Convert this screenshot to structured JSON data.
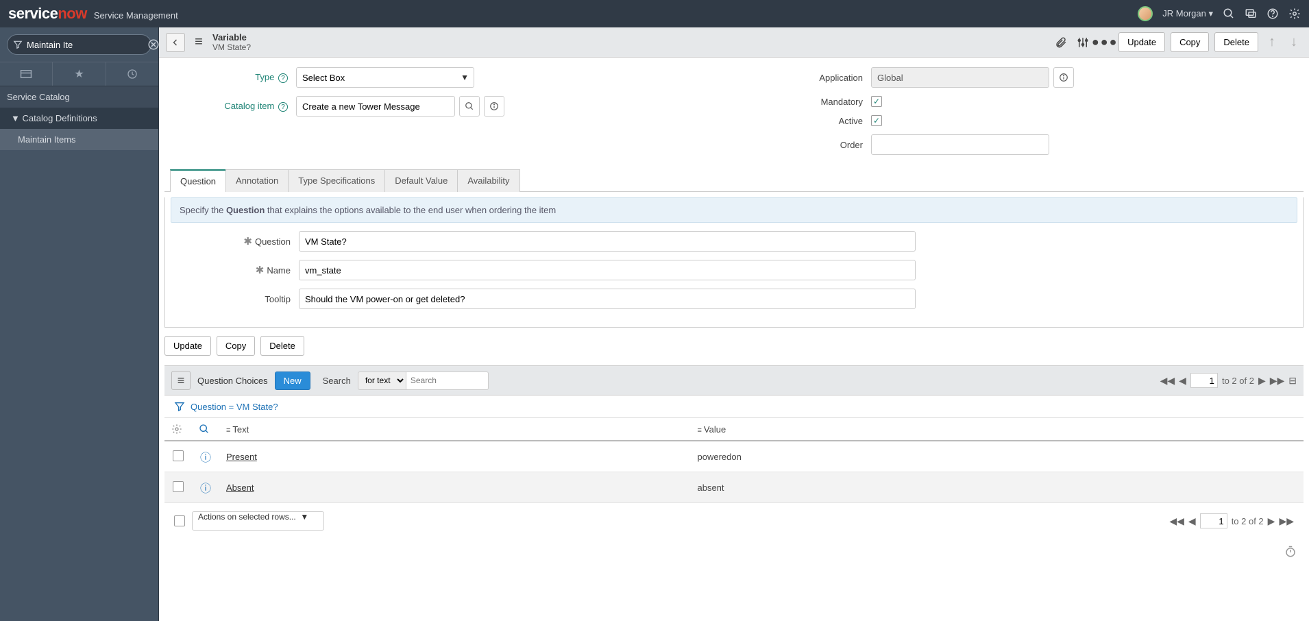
{
  "banner": {
    "logo_prefix": "service",
    "logo_suffix": "now",
    "product": "Service Management",
    "user_name": "JR Morgan"
  },
  "nav": {
    "filter_value": "Maintain Ite",
    "section_title": "Service Catalog",
    "subsection": "Catalog Definitions",
    "item": "Maintain Items"
  },
  "form_header": {
    "title": "Variable",
    "subtitle": "VM State?",
    "update": "Update",
    "copy": "Copy",
    "delete": "Delete"
  },
  "fields": {
    "type_label": "Type",
    "type_value": "Select Box",
    "catalog_item_label": "Catalog item",
    "catalog_item_value": "Create a new Tower Message",
    "application_label": "Application",
    "application_value": "Global",
    "mandatory_label": "Mandatory",
    "active_label": "Active",
    "order_label": "Order",
    "order_value": ""
  },
  "tabs": {
    "question": "Question",
    "annotation": "Annotation",
    "type_spec": "Type Specifications",
    "default_value": "Default Value",
    "availability": "Availability"
  },
  "tab_content": {
    "info_prefix": "Specify the ",
    "info_bold": "Question",
    "info_suffix": " that explains the options available to the end user when ordering the item",
    "question_label": "Question",
    "question_value": "VM State?",
    "name_label": "Name",
    "name_value": "vm_state",
    "tooltip_label": "Tooltip",
    "tooltip_value": "Should the VM power-on or get deleted?"
  },
  "btns": {
    "update": "Update",
    "copy": "Copy",
    "delete": "Delete"
  },
  "related": {
    "title": "Question Choices",
    "new_btn": "New",
    "search_label": "Search",
    "search_selector": "for text",
    "search_placeholder": "Search",
    "page_current": "1",
    "page_text": "to 2 of 2"
  },
  "crumb": {
    "text": "Question = VM State?"
  },
  "col_text": "Text",
  "col_value": "Value",
  "rows": [
    {
      "text": "Present",
      "value": "poweredon"
    },
    {
      "text": "Absent",
      "value": "absent"
    }
  ],
  "bottom": {
    "actions": "Actions on selected rows...",
    "page_current": "1",
    "page_text": "to 2 of 2"
  }
}
